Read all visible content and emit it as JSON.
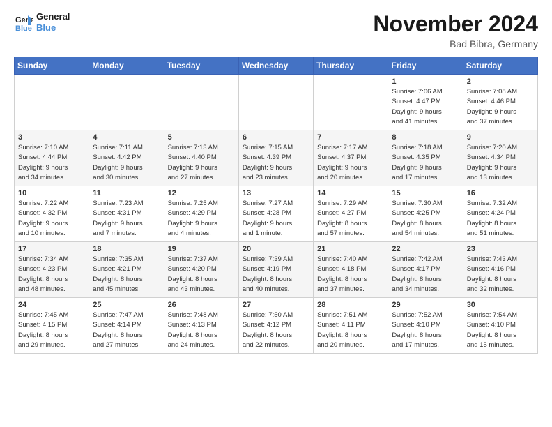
{
  "logo": {
    "line1": "General",
    "line2": "Blue"
  },
  "title": "November 2024",
  "location": "Bad Bibra, Germany",
  "weekdays": [
    "Sunday",
    "Monday",
    "Tuesday",
    "Wednesday",
    "Thursday",
    "Friday",
    "Saturday"
  ],
  "weeks": [
    [
      {
        "day": "",
        "info": ""
      },
      {
        "day": "",
        "info": ""
      },
      {
        "day": "",
        "info": ""
      },
      {
        "day": "",
        "info": ""
      },
      {
        "day": "",
        "info": ""
      },
      {
        "day": "1",
        "info": "Sunrise: 7:06 AM\nSunset: 4:47 PM\nDaylight: 9 hours\nand 41 minutes."
      },
      {
        "day": "2",
        "info": "Sunrise: 7:08 AM\nSunset: 4:46 PM\nDaylight: 9 hours\nand 37 minutes."
      }
    ],
    [
      {
        "day": "3",
        "info": "Sunrise: 7:10 AM\nSunset: 4:44 PM\nDaylight: 9 hours\nand 34 minutes."
      },
      {
        "day": "4",
        "info": "Sunrise: 7:11 AM\nSunset: 4:42 PM\nDaylight: 9 hours\nand 30 minutes."
      },
      {
        "day": "5",
        "info": "Sunrise: 7:13 AM\nSunset: 4:40 PM\nDaylight: 9 hours\nand 27 minutes."
      },
      {
        "day": "6",
        "info": "Sunrise: 7:15 AM\nSunset: 4:39 PM\nDaylight: 9 hours\nand 23 minutes."
      },
      {
        "day": "7",
        "info": "Sunrise: 7:17 AM\nSunset: 4:37 PM\nDaylight: 9 hours\nand 20 minutes."
      },
      {
        "day": "8",
        "info": "Sunrise: 7:18 AM\nSunset: 4:35 PM\nDaylight: 9 hours\nand 17 minutes."
      },
      {
        "day": "9",
        "info": "Sunrise: 7:20 AM\nSunset: 4:34 PM\nDaylight: 9 hours\nand 13 minutes."
      }
    ],
    [
      {
        "day": "10",
        "info": "Sunrise: 7:22 AM\nSunset: 4:32 PM\nDaylight: 9 hours\nand 10 minutes."
      },
      {
        "day": "11",
        "info": "Sunrise: 7:23 AM\nSunset: 4:31 PM\nDaylight: 9 hours\nand 7 minutes."
      },
      {
        "day": "12",
        "info": "Sunrise: 7:25 AM\nSunset: 4:29 PM\nDaylight: 9 hours\nand 4 minutes."
      },
      {
        "day": "13",
        "info": "Sunrise: 7:27 AM\nSunset: 4:28 PM\nDaylight: 9 hours\nand 1 minute."
      },
      {
        "day": "14",
        "info": "Sunrise: 7:29 AM\nSunset: 4:27 PM\nDaylight: 8 hours\nand 57 minutes."
      },
      {
        "day": "15",
        "info": "Sunrise: 7:30 AM\nSunset: 4:25 PM\nDaylight: 8 hours\nand 54 minutes."
      },
      {
        "day": "16",
        "info": "Sunrise: 7:32 AM\nSunset: 4:24 PM\nDaylight: 8 hours\nand 51 minutes."
      }
    ],
    [
      {
        "day": "17",
        "info": "Sunrise: 7:34 AM\nSunset: 4:23 PM\nDaylight: 8 hours\nand 48 minutes."
      },
      {
        "day": "18",
        "info": "Sunrise: 7:35 AM\nSunset: 4:21 PM\nDaylight: 8 hours\nand 45 minutes."
      },
      {
        "day": "19",
        "info": "Sunrise: 7:37 AM\nSunset: 4:20 PM\nDaylight: 8 hours\nand 43 minutes."
      },
      {
        "day": "20",
        "info": "Sunrise: 7:39 AM\nSunset: 4:19 PM\nDaylight: 8 hours\nand 40 minutes."
      },
      {
        "day": "21",
        "info": "Sunrise: 7:40 AM\nSunset: 4:18 PM\nDaylight: 8 hours\nand 37 minutes."
      },
      {
        "day": "22",
        "info": "Sunrise: 7:42 AM\nSunset: 4:17 PM\nDaylight: 8 hours\nand 34 minutes."
      },
      {
        "day": "23",
        "info": "Sunrise: 7:43 AM\nSunset: 4:16 PM\nDaylight: 8 hours\nand 32 minutes."
      }
    ],
    [
      {
        "day": "24",
        "info": "Sunrise: 7:45 AM\nSunset: 4:15 PM\nDaylight: 8 hours\nand 29 minutes."
      },
      {
        "day": "25",
        "info": "Sunrise: 7:47 AM\nSunset: 4:14 PM\nDaylight: 8 hours\nand 27 minutes."
      },
      {
        "day": "26",
        "info": "Sunrise: 7:48 AM\nSunset: 4:13 PM\nDaylight: 8 hours\nand 24 minutes."
      },
      {
        "day": "27",
        "info": "Sunrise: 7:50 AM\nSunset: 4:12 PM\nDaylight: 8 hours\nand 22 minutes."
      },
      {
        "day": "28",
        "info": "Sunrise: 7:51 AM\nSunset: 4:11 PM\nDaylight: 8 hours\nand 20 minutes."
      },
      {
        "day": "29",
        "info": "Sunrise: 7:52 AM\nSunset: 4:10 PM\nDaylight: 8 hours\nand 17 minutes."
      },
      {
        "day": "30",
        "info": "Sunrise: 7:54 AM\nSunset: 4:10 PM\nDaylight: 8 hours\nand 15 minutes."
      }
    ]
  ]
}
